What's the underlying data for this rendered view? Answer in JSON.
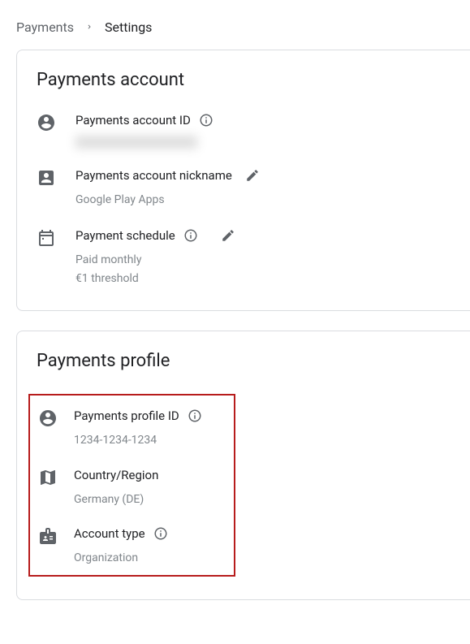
{
  "breadcrumb": {
    "parent": "Payments",
    "current": "Settings"
  },
  "account_card": {
    "title": "Payments account",
    "account_id": {
      "label": "Payments account ID",
      "value_redacted": true
    },
    "nickname": {
      "label": "Payments account nickname",
      "value": "Google Play Apps"
    },
    "schedule": {
      "label": "Payment schedule",
      "value_line1": "Paid monthly",
      "value_line2": "€1 threshold"
    }
  },
  "profile_card": {
    "title": "Payments profile",
    "profile_id": {
      "label": "Payments profile ID",
      "value": "1234-1234-1234"
    },
    "country": {
      "label": "Country/Region",
      "value": "Germany (DE)"
    },
    "account_type": {
      "label": "Account type",
      "value": "Organization"
    }
  }
}
